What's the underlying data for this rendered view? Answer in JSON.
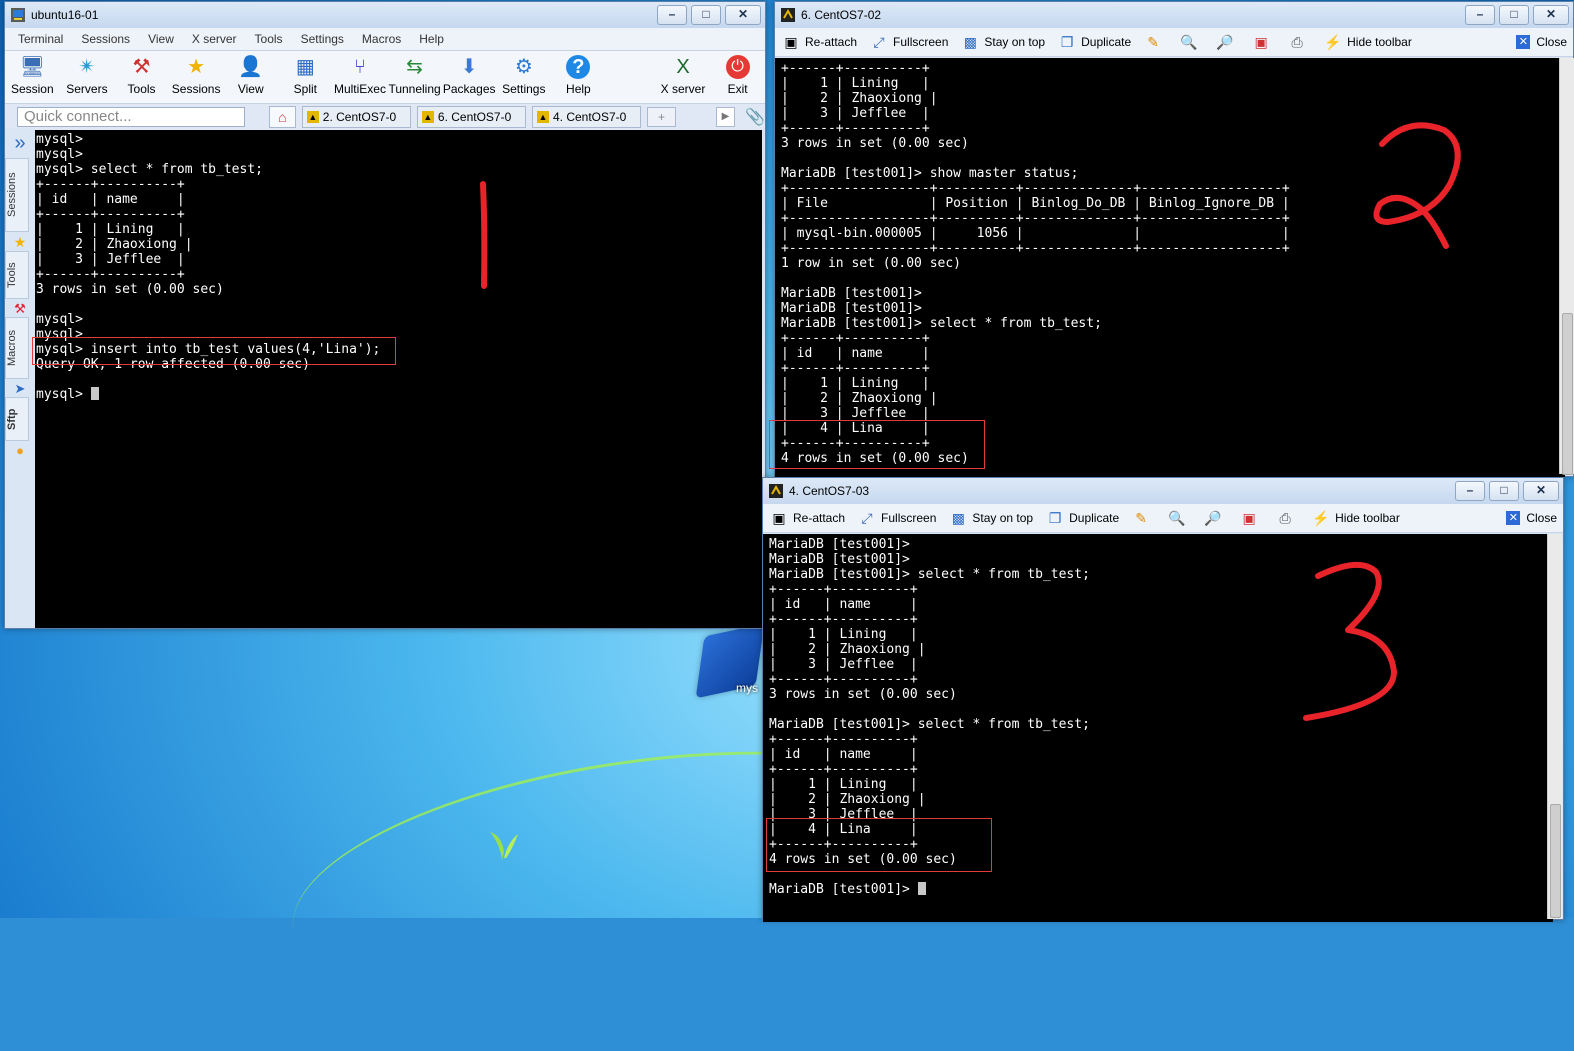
{
  "desktop": {
    "icon_label": "mys"
  },
  "win1": {
    "title": "ubuntu16-01",
    "menu": [
      "Terminal",
      "Sessions",
      "View",
      "X server",
      "Tools",
      "Settings",
      "Macros",
      "Help"
    ],
    "ribbon": [
      {
        "label": "Session",
        "icon": "monitor-icon"
      },
      {
        "label": "Servers",
        "icon": "servers-icon"
      },
      {
        "label": "Tools",
        "icon": "tools-icon"
      },
      {
        "label": "Sessions",
        "icon": "star-icon"
      },
      {
        "label": "View",
        "icon": "view-icon"
      },
      {
        "label": "Split",
        "icon": "split-icon"
      },
      {
        "label": "MultiExec",
        "icon": "multiexec-icon"
      },
      {
        "label": "Tunneling",
        "icon": "tunneling-icon"
      },
      {
        "label": "Packages",
        "icon": "packages-icon"
      },
      {
        "label": "Settings",
        "icon": "settings-gear-icon"
      },
      {
        "label": "Help",
        "icon": "help-icon"
      },
      {
        "label": "X server",
        "icon": "xserver-icon"
      },
      {
        "label": "Exit",
        "icon": "power-icon"
      }
    ],
    "quick_connect_placeholder": "Quick connect...",
    "tabs": [
      "2. CentOS7-0",
      "6. CentOS7-0",
      "4. CentOS7-0"
    ],
    "side_tabs": [
      "Sessions",
      "Tools",
      "Macros",
      "Sftp"
    ],
    "terminal": "mysql>\nmysql>\nmysql> select * from tb_test;\n+------+----------+\n| id   | name     |\n+------+----------+\n|    1 | Lining   |\n|    2 | Zhaoxiong |\n|    3 | Jefflee  |\n+------+----------+\n3 rows in set (0.00 sec)\n\nmysql>\nmysql>\nmysql> insert into tb_test values(4,'Lina');\nQuery OK, 1 row affected (0.00 sec)\n\nmysql> ",
    "annotation": "1"
  },
  "win2": {
    "title": "6. CentOS7-02",
    "toolbar": [
      "Re-attach",
      "Fullscreen",
      "Stay on top",
      "Duplicate",
      "",
      "",
      "",
      "",
      "",
      "Hide toolbar"
    ],
    "close_label": "Close",
    "terminal": "+------+----------+\n|    1 | Lining   |\n|    2 | Zhaoxiong |\n|    3 | Jefflee  |\n+------+----------+\n3 rows in set (0.00 sec)\n\nMariaDB [test001]> show master status;\n+------------------+----------+--------------+------------------+\n| File             | Position | Binlog_Do_DB | Binlog_Ignore_DB |\n+------------------+----------+--------------+------------------+\n| mysql-bin.000005 |     1056 |              |                  |\n+------------------+----------+--------------+------------------+\n1 row in set (0.00 sec)\n\nMariaDB [test001]>\nMariaDB [test001]>\nMariaDB [test001]> select * from tb_test;\n+------+----------+\n| id   | name     |\n+------+----------+\n|    1 | Lining   |\n|    2 | Zhaoxiong |\n|    3 | Jefflee  |\n|    4 | Lina     |\n+------+----------+\n4 rows in set (0.00 sec)",
    "annotation": "2"
  },
  "win3": {
    "title": "4. CentOS7-03",
    "toolbar": [
      "Re-attach",
      "Fullscreen",
      "Stay on top",
      "Duplicate",
      "",
      "",
      "",
      "",
      "",
      "Hide toolbar"
    ],
    "close_label": "Close",
    "terminal": "MariaDB [test001]>\nMariaDB [test001]>\nMariaDB [test001]> select * from tb_test;\n+------+----------+\n| id   | name     |\n+------+----------+\n|    1 | Lining   |\n|    2 | Zhaoxiong |\n|    3 | Jefflee  |\n+------+----------+\n3 rows in set (0.00 sec)\n\nMariaDB [test001]> select * from tb_test;\n+------+----------+\n| id   | name     |\n+------+----------+\n|    1 | Lining   |\n|    2 | Zhaoxiong |\n|    3 | Jefflee  |\n|    4 | Lina     |\n+------+----------+\n4 rows in set (0.00 sec)\n\nMariaDB [test001]> ",
    "annotation": "3"
  },
  "colors": {
    "annotation_red": "#e8232a",
    "terminal_bg": "#000000",
    "terminal_fg": "#ffffff"
  }
}
